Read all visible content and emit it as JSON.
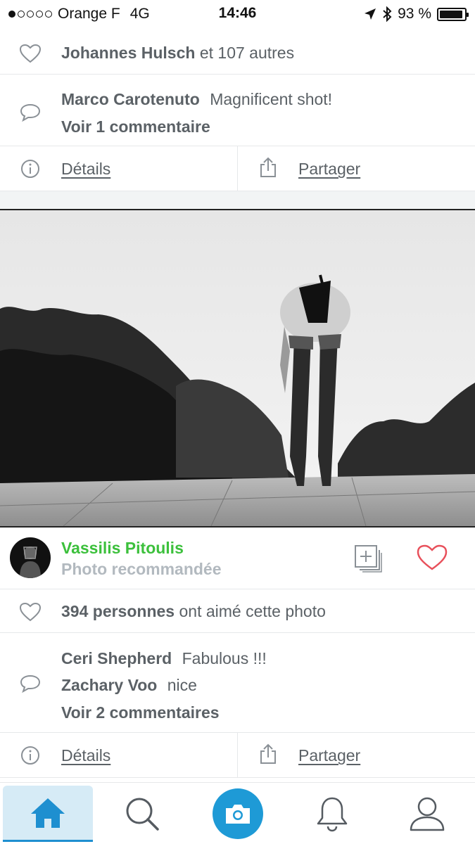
{
  "status_bar": {
    "carrier": "Orange F",
    "network": "4G",
    "time": "14:46",
    "battery": "93 %",
    "battery_level": 0.93
  },
  "post1": {
    "likes_name": "Johannes Hulsch",
    "likes_rest": "et 107 autres",
    "comment_author": "Marco Carotenuto",
    "comment_text": "Magnificent shot!",
    "view_comments": "Voir 1 commentaire",
    "details_label": "Détails",
    "share_label": "Partager"
  },
  "post2": {
    "author_name": "Vassilis Pitoulis",
    "author_subtitle": "Photo recommandée",
    "likes_count": "394 personnes",
    "likes_rest": "ont aimé cette photo",
    "comments": [
      {
        "author": "Ceri Shepherd",
        "text": "Fabulous !!!"
      },
      {
        "author": "Zachary Voo",
        "text": "nice"
      }
    ],
    "view_comments": "Voir 2 commentaires",
    "details_label": "Détails",
    "share_label": "Partager",
    "like_color": "#e8505b"
  },
  "tabbar": {
    "tabs": [
      "home-icon",
      "search-icon",
      "camera-icon",
      "bell-icon",
      "profile-icon"
    ],
    "accent": "#1e9ad6"
  }
}
